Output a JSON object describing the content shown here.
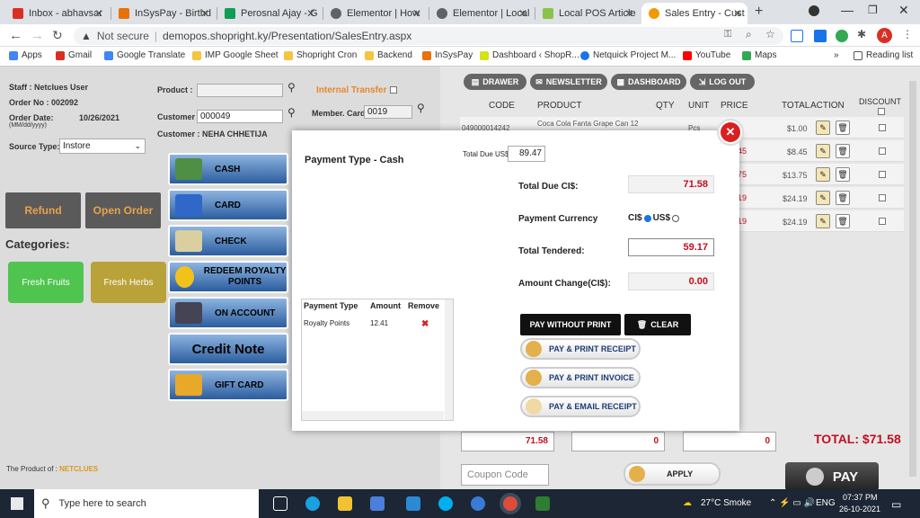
{
  "browser": {
    "tabs": [
      {
        "label": "Inbox - abhavsar",
        "color": "#d93025",
        "active": false
      },
      {
        "label": "InSysPay - Birthd",
        "color": "#e8710a",
        "active": false
      },
      {
        "label": "Perosnal Ajay - G",
        "color": "#0f9d58",
        "active": false
      },
      {
        "label": "Elementor | How",
        "color": "#5f6368",
        "active": false
      },
      {
        "label": "Elementor | Local",
        "color": "#5f6368",
        "active": false
      },
      {
        "label": "Local POS Article",
        "color": "#8bc34a",
        "active": false
      },
      {
        "label": "Sales Entry - Cust",
        "color": "#f29900",
        "active": true
      }
    ],
    "new_tab": "+",
    "not_secure": "Not secure",
    "url": "demopos.shopright.ky/Presentation/SalesEntry.aspx",
    "bookmarks": [
      "Apps",
      "Gmail",
      "Google Translate",
      "IMP Google Sheet",
      "Shopright Cron",
      "Backend",
      "InSysPay",
      "Dashboard ‹ ShopR...",
      "Netquick Project M...",
      "YouTube",
      "Maps"
    ],
    "reading_list": "Reading list",
    "profile": "A"
  },
  "left": {
    "staff": "Staff : Netclues User",
    "order_no": "Order No : 002092",
    "order_date_label": "Order Date:",
    "order_date_fmt": "(MM/dd/yyyy)",
    "order_date": "10/26/2021",
    "source_label": "Source Type:",
    "source_value": "Instore",
    "product_label": "Product :",
    "customer_label": "Customer :",
    "customer_value": "000049",
    "customer_name": "Customer : NEHA CHHETIJA",
    "internal_transfer": "Internal Transfer",
    "member_card_label": "Member. Card:",
    "member_card_value": "0019",
    "refund": "Refund",
    "open_order": "Open Order",
    "categories_title": "Categories:",
    "categories": [
      {
        "label": "Fresh Fruits",
        "color": "#4fc44f"
      },
      {
        "label": "Fresh Herbs",
        "color": "#b9a23a"
      }
    ],
    "product_of": "The Product of :",
    "brand": "NETCLUES"
  },
  "right": {
    "buttons": [
      "DRAWER",
      "NEWSLETTER",
      "DASHBOARD",
      "LOG OUT"
    ],
    "columns": [
      "CODE",
      "PRODUCT",
      "QTY",
      "UNIT",
      "PRICE",
      "TOTAL",
      "ACTION",
      "DISCOUNT"
    ],
    "first_row": {
      "code": "049000014242",
      "product": "Coca Cola Fanta Grape Can 12",
      "unit": "Pcs"
    },
    "price_fragments": [
      "45",
      "75",
      "19",
      "19"
    ],
    "totals": [
      "$1.00",
      "$8.45",
      "$13.75",
      "$24.19",
      "$24.19"
    ],
    "footer_values": [
      "71.58",
      "0",
      "0"
    ],
    "total_label": "TOTAL: $71.58",
    "coupon_placeholder": "Coupon Code",
    "apply": "APPLY",
    "pay": "PAY"
  },
  "modal": {
    "payment_type": "Payment Type - Cash",
    "total_due_us_label": "Total Due US$",
    "total_due_us": "89.47",
    "total_due_ci_label": "Total Due CI$:",
    "total_due_ci": "71.58",
    "currency_label": "Payment Currency",
    "currency_ci": "CI$",
    "currency_us": "US$",
    "tendered_label": "Total Tendered:",
    "tendered": "59.17",
    "change_label": "Amount Change(CI$):",
    "change": "0.00",
    "methods": [
      "CASH",
      "CARD",
      "CHECK",
      "REDEEM ROYALTY POINTS",
      "ON ACCOUNT",
      "Credit Note",
      "GIFT CARD"
    ],
    "table_headers": [
      "Payment Type",
      "Amount",
      "Remove"
    ],
    "table_rows": [
      {
        "type": "Royalty Points",
        "amount": "12.41"
      }
    ],
    "pay_without_print": "PAY WITHOUT PRINT",
    "clear": "CLEAR",
    "pay_print_receipt": "PAY & PRINT RECEIPT",
    "pay_print_invoice": "PAY & PRINT INVOICE",
    "pay_email_receipt": "PAY & EMAIL RECEIPT"
  },
  "taskbar": {
    "search": "Type here to search",
    "weather": "27°C  Smoke",
    "lang": "ENG",
    "time": "07:37 PM",
    "date": "26-10-2021"
  }
}
